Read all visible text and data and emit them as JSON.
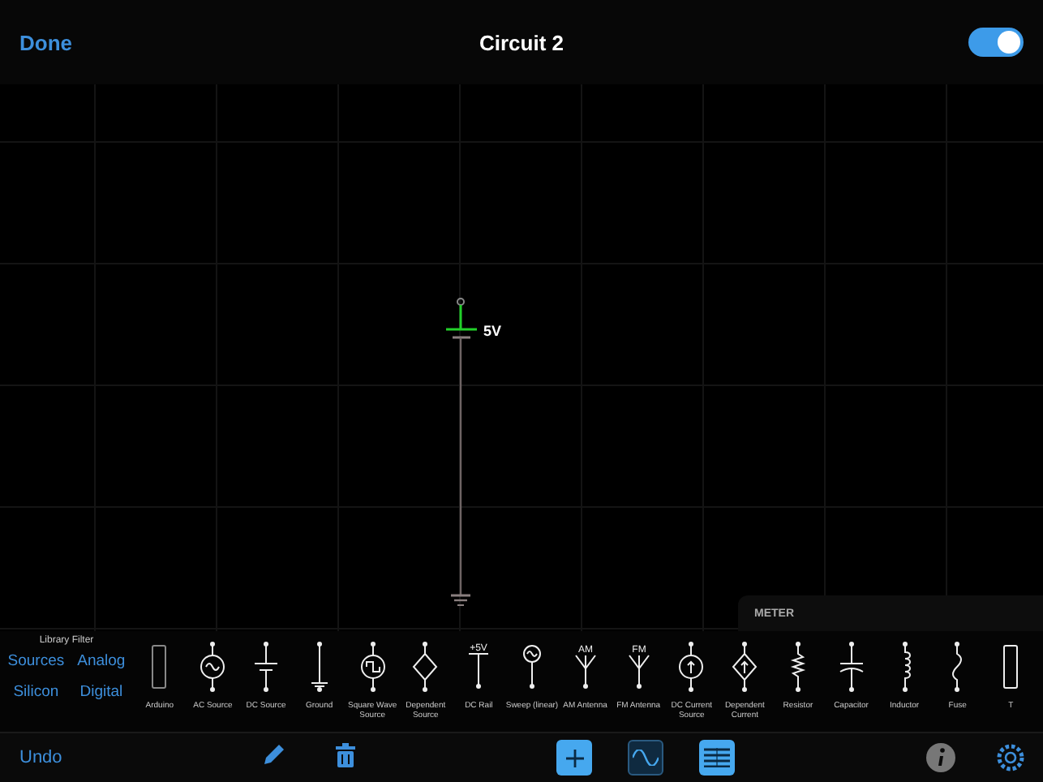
{
  "header": {
    "done": "Done",
    "title": "Circuit 2",
    "toggle_on": true
  },
  "canvas": {
    "component": {
      "kind": "dc_rail",
      "label": "5V",
      "selected": true
    }
  },
  "meter": {
    "label": "METER"
  },
  "library_filter": {
    "title": "Library Filter",
    "filters": [
      {
        "label": "Sources"
      },
      {
        "label": "Analog"
      },
      {
        "label": "Silicon"
      },
      {
        "label": "Digital"
      }
    ]
  },
  "library": [
    {
      "kind": "arduino",
      "label": "Arduino"
    },
    {
      "kind": "ac",
      "label": "AC Source"
    },
    {
      "kind": "dc",
      "label": "DC Source"
    },
    {
      "kind": "ground",
      "label": "Ground"
    },
    {
      "kind": "square",
      "label": "Square Wave Source"
    },
    {
      "kind": "dependent",
      "label": "Dependent Source"
    },
    {
      "kind": "rail",
      "label": "DC Rail",
      "symbol": "+5V"
    },
    {
      "kind": "sweep",
      "label": "Sweep (linear)"
    },
    {
      "kind": "antenna",
      "label": "AM Antenna",
      "symbol": "AM"
    },
    {
      "kind": "antenna",
      "label": "FM Antenna",
      "symbol": "FM"
    },
    {
      "kind": "current",
      "label": "DC Current Source"
    },
    {
      "kind": "depcurrent",
      "label": "Dependent Current"
    },
    {
      "kind": "resistor",
      "label": "Resistor"
    },
    {
      "kind": "capacitor",
      "label": "Capacitor"
    },
    {
      "kind": "inductor",
      "label": "Inductor"
    },
    {
      "kind": "fuse",
      "label": "Fuse"
    },
    {
      "kind": "partial",
      "label": "T"
    }
  ],
  "toolbar": {
    "undo": "Undo",
    "tools": [
      {
        "kind": "add",
        "selected": true
      },
      {
        "kind": "wave",
        "selected": false
      },
      {
        "kind": "list",
        "selected": true
      }
    ]
  }
}
